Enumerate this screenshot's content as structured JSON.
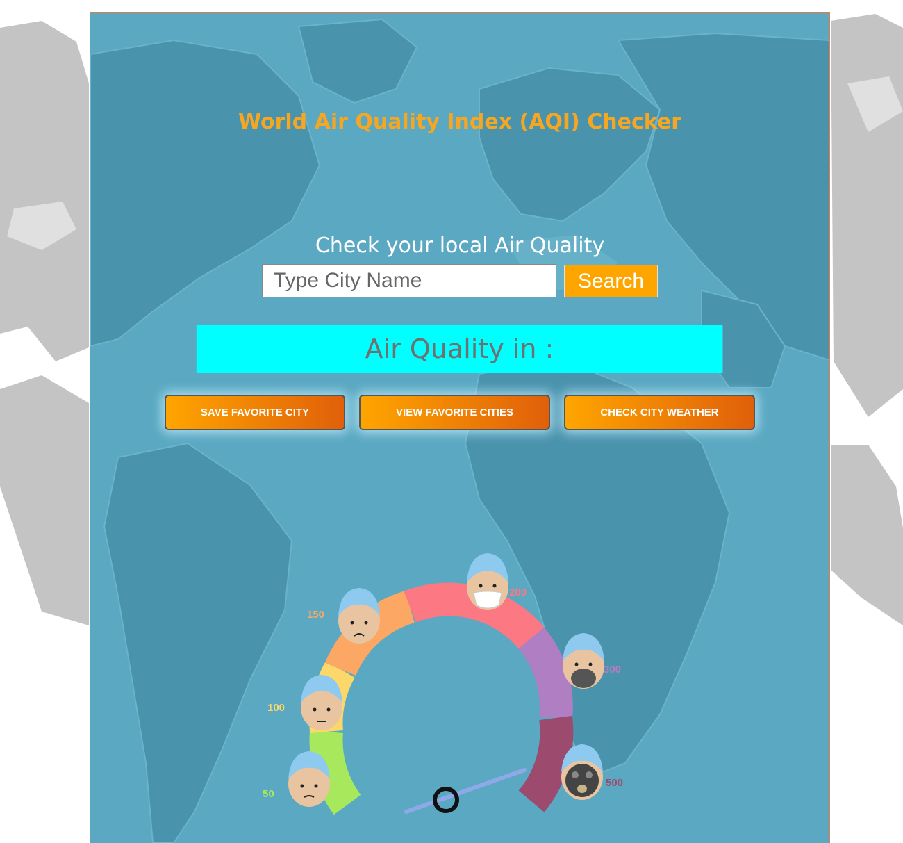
{
  "header": {
    "title": "World Air Quality Index (AQI) Checker"
  },
  "search": {
    "heading": "Check your local Air Quality",
    "placeholder": "Type City Name",
    "value": "",
    "button_label": "Search"
  },
  "result": {
    "label": "Air Quality in :"
  },
  "actions": {
    "save_label": "SAVE FAVORITE CITY",
    "view_label": "VIEW FAVORITE CITIES",
    "weather_label": "CHECK CITY WEATHER"
  },
  "gauge": {
    "scale_labels": [
      "50",
      "100",
      "150",
      "200",
      "300",
      "500"
    ],
    "segment_colors": [
      "#a8e85c",
      "#fcd86a",
      "#fca864",
      "#fc7882",
      "#b07ec2",
      "#9c4a6e"
    ],
    "needle_color": "#8fa8e8"
  },
  "colors": {
    "accent": "#ffa500",
    "title": "#f5a623",
    "result_bg": "#00ffff",
    "app_bg": "#5aa8c2"
  }
}
